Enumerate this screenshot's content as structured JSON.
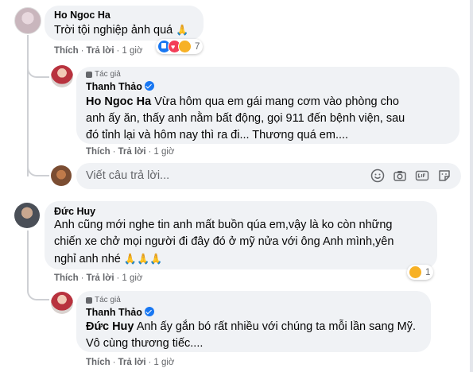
{
  "comments": [
    {
      "author": "Ho Ngoc Ha",
      "text": "Trời tội nghiệp ảnh quá",
      "emoji": "🙏",
      "like_label": "Thích",
      "reply_label": "Trả lời",
      "time": "1 giờ",
      "reactions_count": "7",
      "reactions": [
        "like-icon",
        "love-icon",
        "sad-icon"
      ],
      "reply": {
        "author_badge": "Tác giả",
        "author": "Thanh Thảo",
        "tagged": "Ho Ngoc Ha",
        "text_line1": " Vừa hôm qua em gái mang cơm vào phòng cho",
        "text_line2": "anh ấy ăn, thấy anh nằm bất động, gọi 911 đến bệnh viện, sau",
        "text_line3": "đó tỉnh lại và hôm nay thì ra đi... Thương quá em....",
        "like_label": "Thích",
        "reply_label": "Trả lời",
        "time": "1 giờ"
      },
      "reply_placeholder": "Viết câu trả lời..."
    },
    {
      "author": "Đức Huy",
      "text_line1": "Anh cũng mới nghe tin anh mất buồn qúa em,vậy là ko còn những",
      "text_line2": "chiến xe chở mọi người đi đây đó ở mỹ nửa với ông Anh mình,yên",
      "text_line3": "nghỉ anh nhé",
      "emoji": "🙏🙏🙏",
      "like_label": "Thích",
      "reply_label": "Trả lời",
      "time": "1 giờ",
      "reactions_count": "1",
      "reactions": [
        "sad-icon"
      ],
      "reply": {
        "author_badge": "Tác giả",
        "author": "Thanh Thảo",
        "tagged": "Đức Huy",
        "text_line1": " Anh ấy gắn bó rất nhiều với chúng ta mỗi lần sang Mỹ.",
        "text_line2": "Vô cùng thương tiếc....",
        "like_label": "Thích",
        "reply_label": "Trả lời",
        "time": "1 giờ"
      }
    }
  ],
  "colors": {
    "bubble": "#f0f2f5",
    "secondary_text": "#65676b",
    "verified": "#1877f2"
  }
}
